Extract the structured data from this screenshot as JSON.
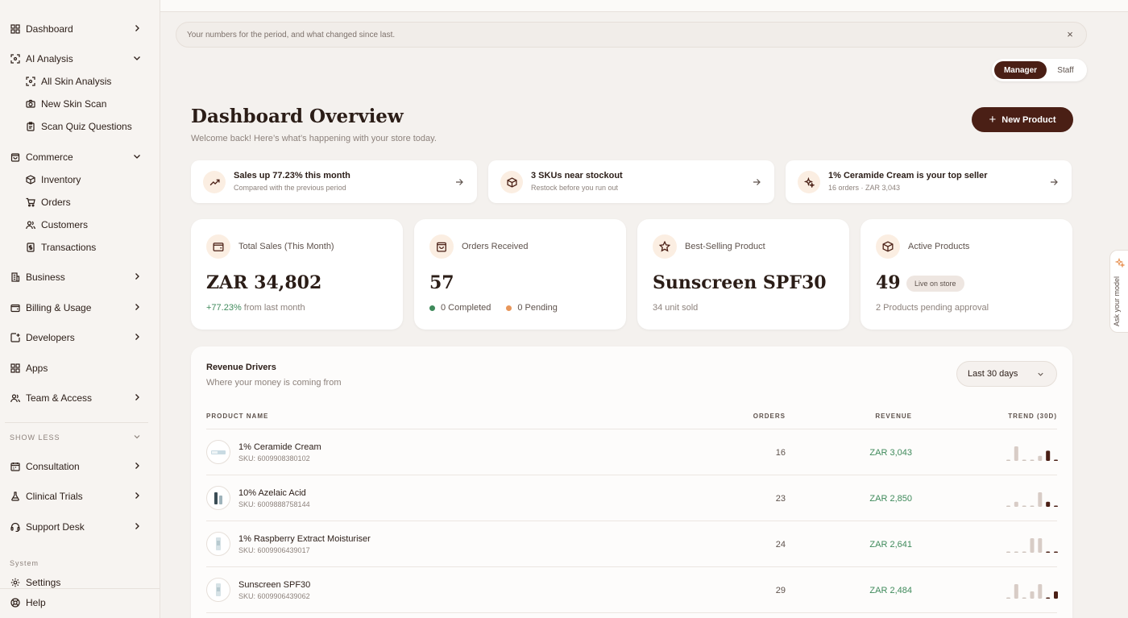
{
  "sidebar": {
    "items": [
      {
        "label": "Dashboard"
      },
      {
        "label": "AI Analysis"
      },
      {
        "label": "All Skin Analysis"
      },
      {
        "label": "New Skin Scan"
      },
      {
        "label": "Scan Quiz Questions"
      },
      {
        "label": "Commerce"
      },
      {
        "label": "Inventory"
      },
      {
        "label": "Orders"
      },
      {
        "label": "Customers"
      },
      {
        "label": "Transactions"
      },
      {
        "label": "Business"
      },
      {
        "label": "Billing & Usage"
      },
      {
        "label": "Developers"
      },
      {
        "label": "Apps"
      },
      {
        "label": "Team & Access"
      }
    ],
    "show_less": "SHOW LESS",
    "more_items": [
      {
        "label": "Consultation"
      },
      {
        "label": "Clinical Trials"
      },
      {
        "label": "Support Desk"
      }
    ],
    "system_label": "System",
    "system_items": [
      {
        "label": "Settings"
      },
      {
        "label": "Help"
      }
    ]
  },
  "notice": {
    "text": "Your numbers for the period, and what changed since last.",
    "close": "×"
  },
  "role_toggle": {
    "active": "Manager",
    "inactive": "Staff"
  },
  "header": {
    "title": "Dashboard Overview",
    "subtitle": "Welcome back! Here’s what’s happening with your store today.",
    "new_product": "New Product"
  },
  "insights": [
    {
      "title": "Sales up 77.23% this month",
      "subtitle": "Compared with the previous period"
    },
    {
      "title": "3 SKUs near stockout",
      "subtitle": "Restock before you run out"
    },
    {
      "title": "1% Ceramide Cream is your top seller",
      "subtitle": "16 orders · ZAR 3,043"
    }
  ],
  "stats": {
    "total_sales": {
      "label": "Total Sales (This Month)",
      "value": "ZAR 34,802",
      "change": "+77.23%",
      "change_suffix": "from last month"
    },
    "orders": {
      "label": "Orders Received",
      "value": "57",
      "completed": "0 Completed",
      "pending": "0 Pending"
    },
    "best_seller": {
      "label": "Best-Selling Product",
      "value": "Sunscreen SPF30",
      "foot": "34 unit sold"
    },
    "active_products": {
      "label": "Active Products",
      "value": "49",
      "badge": "Live on store",
      "foot": "2 Products pending approval"
    }
  },
  "revenue": {
    "title": "Revenue Drivers",
    "subtitle": "Where your money is coming from",
    "range": "Last 30 days",
    "columns": {
      "product": "PRODUCT NAME",
      "orders": "ORDERS",
      "revenue": "REVENUE",
      "trend": "TREND (30D)"
    },
    "rows": [
      {
        "name": "1% Ceramide Cream",
        "sku": "SKU: 6009908380102",
        "orders": "16",
        "revenue": "ZAR 3,043",
        "trend": [
          0.05,
          1,
          0.05,
          0.05,
          0.35,
          0.7,
          0.05
        ]
      },
      {
        "name": "10% Azelaic Acid",
        "sku": "SKU: 6009888758144",
        "orders": "23",
        "revenue": "ZAR 2,850",
        "trend": [
          0.05,
          0.35,
          0.05,
          0.05,
          1,
          0.35,
          0.05
        ]
      },
      {
        "name": "1% Raspberry Extract Moisturiser",
        "sku": "SKU: 6009906439017",
        "orders": "24",
        "revenue": "ZAR 2,641",
        "trend": [
          0.05,
          0.05,
          0.05,
          1,
          1,
          0.05,
          0.05
        ]
      },
      {
        "name": "Sunscreen SPF30",
        "sku": "SKU: 6009906439062",
        "orders": "29",
        "revenue": "ZAR 2,484",
        "trend": [
          0.05,
          1,
          0.05,
          0.5,
          1,
          0.05,
          0.5
        ]
      }
    ]
  },
  "ask_tab": {
    "label": "Ask your model"
  },
  "colors": {
    "accent": "#4a1f15",
    "positive": "#3f8a5b",
    "pending": "#e8965a",
    "completed": "#3f8a5b"
  }
}
